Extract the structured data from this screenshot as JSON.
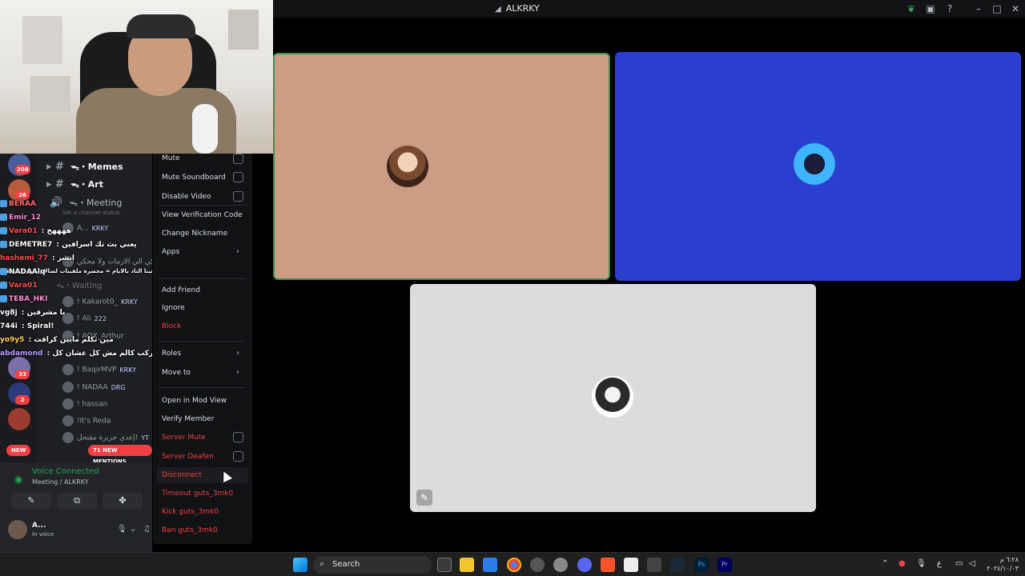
{
  "window": {
    "title": "ALKRKY"
  },
  "titlebar_icons": [
    "leaf-icon",
    "screen-icon",
    "help-icon",
    "minimize-icon",
    "maximize-icon",
    "close-icon"
  ],
  "channels": [
    {
      "name": "ᯓ・Memes"
    },
    {
      "name": "ᯓ・Art"
    },
    {
      "name": "ᯓ・Meeting"
    }
  ],
  "channel_status_placeholder": "Set a channel status",
  "waiting_channel": "ᯓ・Waiting",
  "server_badges": [
    "208",
    "26",
    "33",
    "2"
  ],
  "members": [
    {
      "name": "A...",
      "tag": "KRKY"
    },
    {
      "name": "محكي الي الازمات ولا محكي",
      "tag": ""
    },
    {
      "name": "! Kakarot0_",
      "tag": "KRKY"
    },
    {
      "name": "! Ali",
      "tag": "222"
    },
    {
      "name": "! AQX_Arthur",
      "tag": ""
    },
    {
      "name": "! BaqirMVP",
      "tag": "KRKY"
    },
    {
      "name": "! NADAA",
      "tag": "DRG"
    },
    {
      "name": "! hassan",
      "tag": ""
    },
    {
      "name": "!It's Reda",
      "tag": ""
    },
    {
      "name": "إعدي جزيرة مقتحل!",
      "tag": "YT"
    }
  ],
  "chat": [
    {
      "user": "BERAA",
      "msg": "",
      "color": "#ff6b6b"
    },
    {
      "user": "Emir_12",
      "msg": "",
      "color": "#ff8ad8"
    },
    {
      "user": "Vara01",
      "msg": "ههههخ",
      "color": "#ff4d4d"
    },
    {
      "user": "DEMETRE7",
      "msg": "يعني بث تك اسرافين",
      "color": "#ffffff"
    },
    {
      "user": "hashemi_77",
      "msg": "ابشر",
      "color": "#ff4d4d"
    },
    {
      "user": "",
      "msg": "السبليون جئت موجودة اللي عاملكم بقينا الناد بالايام = محضرة ملفينات لسالار بس خليه يقلح",
      "color": "#ffffff"
    },
    {
      "user": "NADAAlq",
      "msg": "",
      "color": "#ffffff"
    },
    {
      "user": "Vara01",
      "msg": "",
      "color": "#ff4d4d"
    },
    {
      "user": "TEBA_HKI",
      "msg": "",
      "color": "#ff8ad8"
    },
    {
      "user": "vg8j",
      "msg": "يا مشرفين",
      "color": "#ffffff"
    },
    {
      "user": "744i",
      "msg": "Spiral!",
      "color": "#ffffff"
    },
    {
      "user": "yo9y5",
      "msg": "مين تكلم مايين كرافت",
      "color": "#ffd24d"
    },
    {
      "user": "abdamond",
      "msg": "بيست - اركب كالم مش كل عشان كل",
      "color": "#b99cff"
    }
  ],
  "new_label": "NEW",
  "mentions_label": "71 NEW MENTIONS",
  "voice": {
    "status": "Voice Connected",
    "location": "Meeting / ALKRKY",
    "user_name": "A...",
    "user_status": "In voice"
  },
  "context_menu": {
    "mute": "Mute",
    "mute_soundboard": "Mute Soundboard",
    "disable_video": "Disable Video",
    "view_verification_code": "View Verification Code",
    "change_nickname": "Change Nickname",
    "apps": "Apps",
    "add_friend": "Add Friend",
    "ignore": "Ignore",
    "block": "Block",
    "roles": "Roles",
    "move_to": "Move to",
    "open_mod_view": "Open in Mod View",
    "verify_member": "Verify Member",
    "server_mute": "Server Mute",
    "server_deafen": "Server Deafen",
    "disconnect": "Disconnect",
    "timeout": "Timeout guts_3mk0",
    "kick": "Kick guts_3mk0",
    "ban": "Ban guts_3mk0"
  },
  "taskbar": {
    "search_label": "Search",
    "clock_time": "٦:٢٨ م",
    "clock_date": "٢٠٢٤/١٠/٠٣",
    "lang": "ع"
  },
  "colors": {
    "tile_1": "#cc9d82",
    "tile_2": "#2a3fd0",
    "tile_3": "#dcdcdc",
    "speaking_border": "#3e8f52",
    "danger": "#f23f43",
    "voice_green": "#23a55a"
  }
}
